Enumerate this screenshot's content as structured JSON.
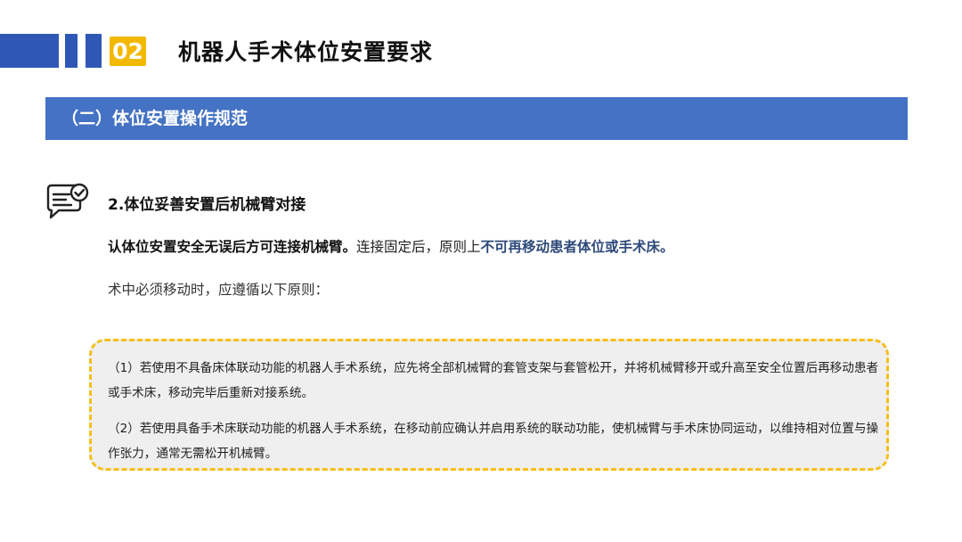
{
  "header": {
    "number": "02",
    "title": "机器人手术体位安置要求"
  },
  "section": {
    "title": "（二）体位安置操作规范"
  },
  "icon": "chat-check-icon",
  "colors": {
    "accent_blue": "#2f57b5",
    "section_blue": "#4472c4",
    "badge_yellow": "#f3b800",
    "dashed_border": "#f5bf1a",
    "highlight_text": "#2e4a7a"
  },
  "content": {
    "sub_heading": "2.体位妥善安置后机械臂对接",
    "para1_bold": "认体位安置安全无误后方可连接机械臂。",
    "para1_plain": "连接固定后，原则上",
    "para1_highlight": "不可再移动患者体位或手术床。",
    "para2": "术中必须移动时，应遵循以下原则：",
    "rules": [
      "（1）若使用不具备床体联动功能的机器人手术系统，应先将全部机械臂的套管支架与套管松开，并将机械臂移开或升高至安全位置后再移动患者或手术床，移动完毕后重新对接系统。",
      "（2）若使用具备手术床联动功能的机器人手术系统，在移动前应确认并启用系统的联动功能，使机械臂与手术床协同运动，以维持相对位置与操作张力，通常无需松开机械臂。"
    ]
  }
}
